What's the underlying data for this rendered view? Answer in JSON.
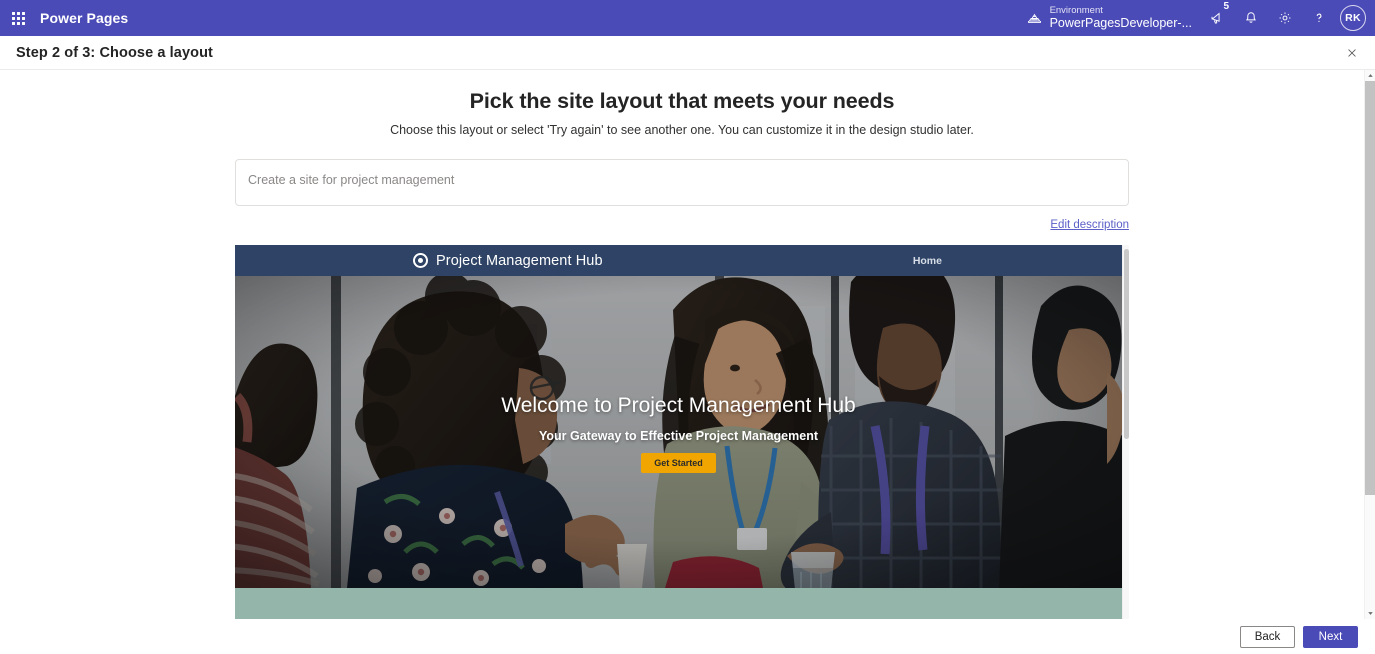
{
  "suitebar": {
    "waffle_label": "App launcher",
    "app_name": "Power Pages",
    "environment_label": "Environment",
    "environment_value": "PowerPagesDeveloper-...",
    "announcements_badge": "5",
    "avatar_initials": "RK"
  },
  "stepbar": {
    "title": "Step 2 of 3: Choose a layout",
    "close_label": "✕"
  },
  "page": {
    "title": "Pick the site layout that meets your needs",
    "subtitle": "Choose this layout or select 'Try again' to see another one. You can customize it in the design studio later."
  },
  "description": {
    "value": "Create a site for project management",
    "placeholder": "Create a site for project management",
    "edit_link": "Edit description"
  },
  "preview": {
    "brand_name": "Project Management Hub",
    "nav_item": "Home",
    "hero_heading": "Welcome to Project Management Hub",
    "hero_subheading": "Your Gateway to Effective Project Management",
    "hero_cta": "Get Started"
  },
  "footer": {
    "back_label": "Back",
    "next_label": "Next"
  },
  "colors": {
    "suitebar_purple": "#4B4BB8",
    "primary_button": "#4B4BB8",
    "site_nav_navy": "#2E4365",
    "cta_orange": "#F0A500",
    "band_teal": "#93B5AA",
    "link_purple": "#5B5FC7"
  }
}
